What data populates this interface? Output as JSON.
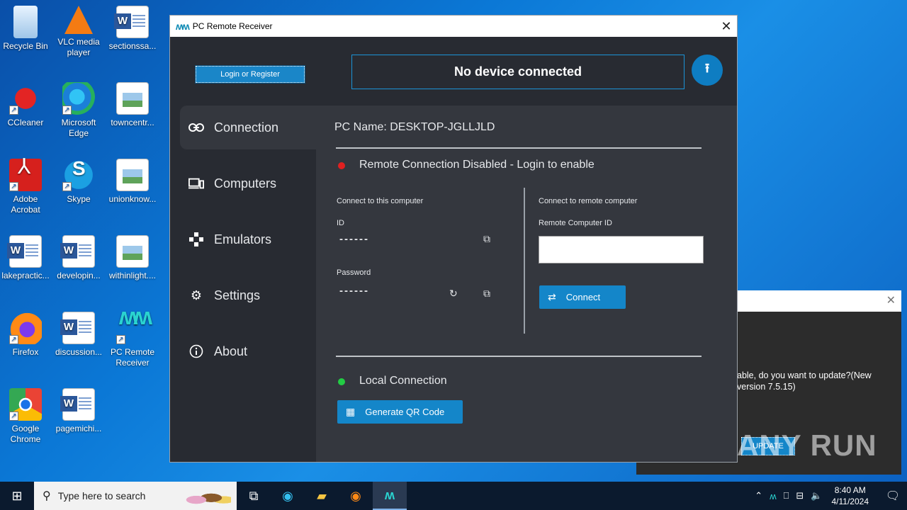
{
  "desktop": {
    "icons": [
      {
        "label": "Recycle Bin"
      },
      {
        "label": "VLC media player"
      },
      {
        "label": "sectionssa..."
      },
      {
        "label": "CCleaner"
      },
      {
        "label": "Microsoft Edge"
      },
      {
        "label": "towncentr..."
      },
      {
        "label": "Adobe Acrobat"
      },
      {
        "label": "Skype"
      },
      {
        "label": "unionknow..."
      },
      {
        "label": "lakepractic..."
      },
      {
        "label": "developin..."
      },
      {
        "label": "withinlight...."
      },
      {
        "label": "Firefox"
      },
      {
        "label": "discussion..."
      },
      {
        "label": "PC Remote Receiver"
      },
      {
        "label": "Google Chrome"
      },
      {
        "label": "pagemichi..."
      }
    ]
  },
  "app": {
    "title": "PC Remote Receiver",
    "login_label": "Login or Register",
    "status": "No device connected",
    "upload_icon": "upload-icon",
    "sidebar": [
      {
        "label": "Connection",
        "icon": "link-icon"
      },
      {
        "label": "Computers",
        "icon": "devices-icon"
      },
      {
        "label": "Emulators",
        "icon": "gamepad-icon"
      },
      {
        "label": "Settings",
        "icon": "gear-icon"
      },
      {
        "label": "About",
        "icon": "info-icon"
      }
    ],
    "pc_name": "PC Name: DESKTOP-JGLLJLD",
    "remote_status": "Remote Connection Disabled - Login to enable",
    "remote_status_color": "#e02020",
    "connect_this_label": "Connect to this computer",
    "id_label": "ID",
    "id_value": "------",
    "password_label": "Password",
    "password_value": "------",
    "connect_remote_label": "Connect to remote computer",
    "remote_id_label": "Remote Computer ID",
    "remote_id_value": "",
    "connect_button": "Connect",
    "local_status": "Local Connection",
    "local_status_color": "#22cc44",
    "qr_button": "Generate QR Code",
    "accent_color": "#1486c9"
  },
  "update_dialog": {
    "message": "able, do you want to update?(New version 7.5.15)",
    "update_button": "UPDATE"
  },
  "watermark": "ANY RUN",
  "taskbar": {
    "search_placeholder": "Type here to search",
    "time": "8:40 AM",
    "date": "4/11/2024"
  }
}
